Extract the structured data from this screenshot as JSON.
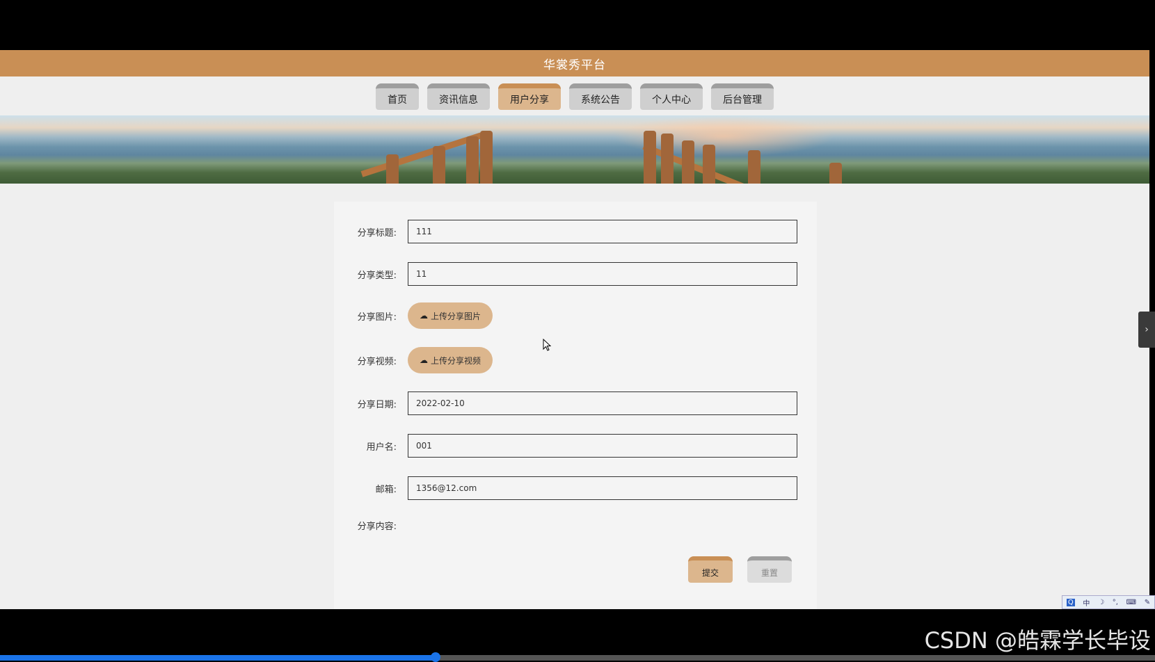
{
  "header": {
    "title": "华裳秀平台"
  },
  "nav": {
    "items": [
      "首页",
      "资讯信息",
      "用户分享",
      "系统公告",
      "个人中心",
      "后台管理"
    ],
    "active_index": 2
  },
  "form": {
    "title_label": "分享标题:",
    "title_value": "111",
    "type_label": "分享类型:",
    "type_value": "11",
    "image_label": "分享图片:",
    "image_button": "上传分享图片",
    "video_label": "分享视频:",
    "video_button": "上传分享视频",
    "date_label": "分享日期:",
    "date_value": "2022-02-10",
    "username_label": "用户名:",
    "username_value": "001",
    "email_label": "邮箱:",
    "email_value": "1356@12.com",
    "content_label": "分享内容:",
    "submit_label": "提交",
    "reset_label": "重置"
  },
  "player": {
    "progress": 0.377
  },
  "ime": {
    "icon": "ime-toolbar-icon",
    "mode": "中"
  },
  "watermark": "CSDN @皓霖学长毕设",
  "colors": {
    "accent": "#c98f55",
    "accent_light": "#dcb68d",
    "progress": "#1a73e8"
  }
}
